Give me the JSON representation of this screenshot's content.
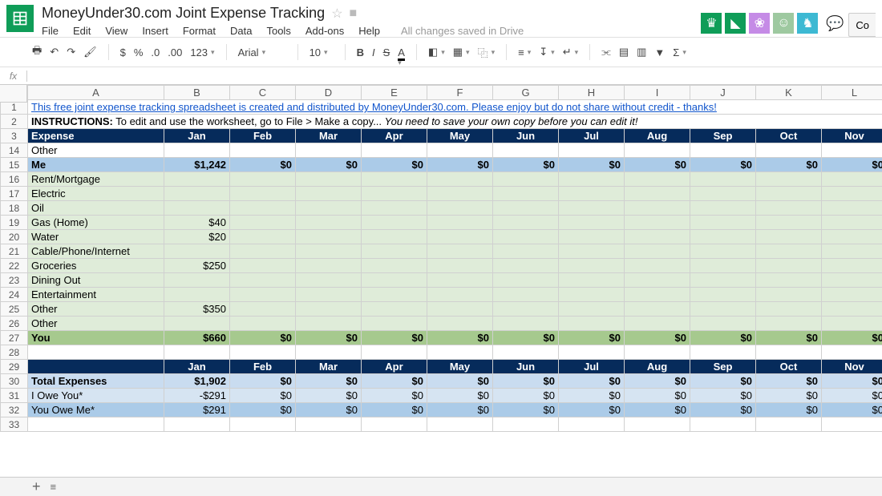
{
  "doc": {
    "title": "MoneyUnder30.com Joint Expense Tracking",
    "save_status": "All changes saved in Drive"
  },
  "menubar": [
    "File",
    "Edit",
    "View",
    "Insert",
    "Format",
    "Data",
    "Tools",
    "Add-ons",
    "Help"
  ],
  "buttons": {
    "comments": "Co"
  },
  "toolbar": {
    "currency": "$",
    "percent": "%",
    "dec1": ".0",
    "dec2": ".00",
    "num": "123",
    "font": "Arial",
    "size": "10",
    "bold": "B",
    "italic": "I",
    "strike": "S",
    "textcolor": "A"
  },
  "cols": [
    "A",
    "B",
    "C",
    "D",
    "E",
    "F",
    "G",
    "H",
    "I",
    "J",
    "K",
    "L"
  ],
  "months": [
    "Jan",
    "Feb",
    "Mar",
    "Apr",
    "May",
    "Jun",
    "Jul",
    "Aug",
    "Sep",
    "Oct",
    "Nov"
  ],
  "link_text": "This free joint expense tracking spreadsheet is created and distributed by MoneyUnder30.com. Please enjoy but do not share without credit - thanks! ",
  "instructions_bold": "INSTRUCTIONS:",
  "instructions_plain": " To edit and use the worksheet, go to File > Make a copy...   ",
  "instructions_italic": "You need to save your own copy before you can edit it!",
  "chart_data": {
    "type": "table",
    "header_cols": [
      "Expense",
      "Jan",
      "Feb",
      "Mar",
      "Apr",
      "May",
      "Jun",
      "Jul",
      "Aug",
      "Sep",
      "Oct",
      "Nov"
    ],
    "rows": [
      {
        "n": "14",
        "label": "Other",
        "vals": [
          "",
          "",
          "",
          "",
          "",
          "",
          "",
          "",
          "",
          "",
          ""
        ],
        "cls": ""
      },
      {
        "n": "15",
        "label": "Me",
        "vals": [
          "$1,242",
          "$0",
          "$0",
          "$0",
          "$0",
          "$0",
          "$0",
          "$0",
          "$0",
          "$0",
          "$0"
        ],
        "cls": "row-meblue"
      },
      {
        "n": "16",
        "label": "Rent/Mortgage",
        "vals": [
          "",
          "",
          "",
          "",
          "",
          "",
          "",
          "",
          "",
          "",
          ""
        ],
        "cls": "row-lightgreen"
      },
      {
        "n": "17",
        "label": "Electric",
        "vals": [
          "",
          "",
          "",
          "",
          "",
          "",
          "",
          "",
          "",
          "",
          ""
        ],
        "cls": "row-lightgreen"
      },
      {
        "n": "18",
        "label": "Oil",
        "vals": [
          "",
          "",
          "",
          "",
          "",
          "",
          "",
          "",
          "",
          "",
          ""
        ],
        "cls": "row-lightgreen"
      },
      {
        "n": "19",
        "label": "Gas (Home)",
        "vals": [
          "$40",
          "",
          "",
          "",
          "",
          "",
          "",
          "",
          "",
          "",
          ""
        ],
        "cls": "row-lightgreen"
      },
      {
        "n": "20",
        "label": "Water",
        "vals": [
          "$20",
          "",
          "",
          "",
          "",
          "",
          "",
          "",
          "",
          "",
          ""
        ],
        "cls": "row-lightgreen"
      },
      {
        "n": "21",
        "label": "Cable/Phone/Internet",
        "vals": [
          "",
          "",
          "",
          "",
          "",
          "",
          "",
          "",
          "",
          "",
          ""
        ],
        "cls": "row-lightgreen"
      },
      {
        "n": "22",
        "label": "Groceries",
        "vals": [
          "$250",
          "",
          "",
          "",
          "",
          "",
          "",
          "",
          "",
          "",
          ""
        ],
        "cls": "row-lightgreen"
      },
      {
        "n": "23",
        "label": "Dining Out",
        "vals": [
          "",
          "",
          "",
          "",
          "",
          "",
          "",
          "",
          "",
          "",
          ""
        ],
        "cls": "row-lightgreen"
      },
      {
        "n": "24",
        "label": "Entertainment",
        "vals": [
          "",
          "",
          "",
          "",
          "",
          "",
          "",
          "",
          "",
          "",
          ""
        ],
        "cls": "row-lightgreen"
      },
      {
        "n": "25",
        "label": "Other",
        "vals": [
          "$350",
          "",
          "",
          "",
          "",
          "",
          "",
          "",
          "",
          "",
          ""
        ],
        "cls": "row-lightgreen"
      },
      {
        "n": "26",
        "label": "Other",
        "vals": [
          "",
          "",
          "",
          "",
          "",
          "",
          "",
          "",
          "",
          "",
          ""
        ],
        "cls": "row-lightgreen"
      },
      {
        "n": "27",
        "label": "You",
        "vals": [
          "$660",
          "$0",
          "$0",
          "$0",
          "$0",
          "$0",
          "$0",
          "$0",
          "$0",
          "$0",
          "$0"
        ],
        "cls": "row-yougreen"
      },
      {
        "n": "28",
        "label": "",
        "vals": [
          "",
          "",
          "",
          "",
          "",
          "",
          "",
          "",
          "",
          "",
          ""
        ],
        "cls": ""
      }
    ],
    "summary_header": {
      "n": "29",
      "label": "",
      "months": [
        "Jan",
        "Feb",
        "Mar",
        "Apr",
        "May",
        "Jun",
        "Jul",
        "Aug",
        "Sep",
        "Oct",
        "Nov"
      ]
    },
    "summary_rows": [
      {
        "n": "30",
        "label": "Total Expenses",
        "vals": [
          "$1,902",
          "$0",
          "$0",
          "$0",
          "$0",
          "$0",
          "$0",
          "$0",
          "$0",
          "$0",
          "$0"
        ],
        "cls": "row-totalblue"
      },
      {
        "n": "31",
        "label": "I Owe You*",
        "vals": [
          "-$291",
          "$0",
          "$0",
          "$0",
          "$0",
          "$0",
          "$0",
          "$0",
          "$0",
          "$0",
          "$0"
        ],
        "cls": "row-paleblue"
      },
      {
        "n": "32",
        "label": "You Owe Me*",
        "vals": [
          "$291",
          "$0",
          "$0",
          "$0",
          "$0",
          "$0",
          "$0",
          "$0",
          "$0",
          "$0",
          "$0"
        ],
        "cls": "row-medblue"
      },
      {
        "n": "33",
        "label": "",
        "vals": [
          "",
          "",
          "",
          "",
          "",
          "",
          "",
          "",
          "",
          "",
          ""
        ],
        "cls": ""
      }
    ]
  }
}
